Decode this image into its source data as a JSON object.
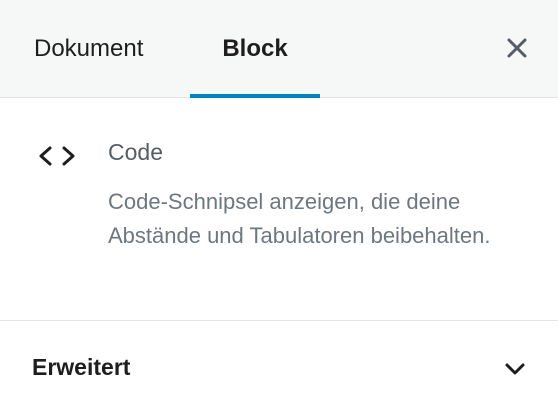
{
  "tabs": {
    "document_label": "Dokument",
    "block_label": "Block"
  },
  "block": {
    "icon": "code-icon",
    "title": "Code",
    "description": "Code-Schnipsel anzeigen, die deine Abstände und Tabulatoren beibehalten."
  },
  "advanced": {
    "label": "Erweitert",
    "icon": "chevron-down-icon"
  },
  "colors": {
    "accent": "#0085ba",
    "tabbar_bg": "#f6f7f7",
    "border": "#e2e4e7",
    "text_dark": "#1e1e1e",
    "text_muted": "#6c7781"
  }
}
